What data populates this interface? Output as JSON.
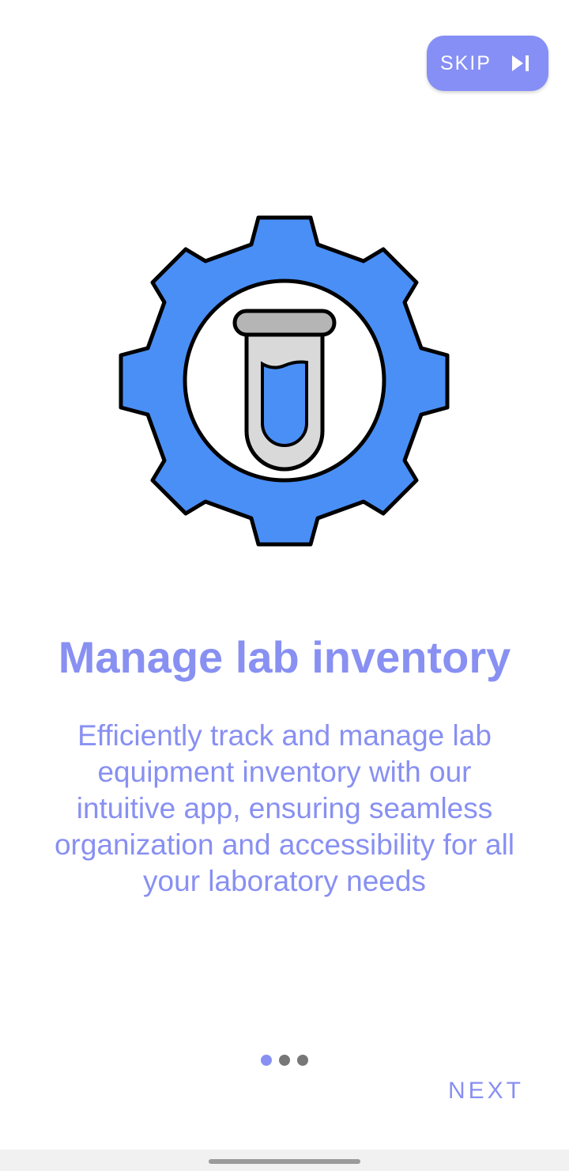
{
  "header": {
    "skip_label": "SKIP",
    "skip_icon": "skip-next-icon"
  },
  "hero": {
    "icon": "gear-test-tube-icon",
    "colors": {
      "gear": "#4a8ff6",
      "tube_liquid": "#4a8ff6",
      "tube_body": "#d9d9d9",
      "tube_cap": "#b5b5b5"
    }
  },
  "content": {
    "title": "Manage lab inventory",
    "description": "Efficiently track and manage lab equipment inventory with our intuitive app, ensuring seamless organization and accessibility for all your laboratory needs"
  },
  "pager": {
    "total": 3,
    "active_index": 0,
    "active_color": "#8890f2",
    "inactive_color": "#777777"
  },
  "footer": {
    "next_label": "NEXT"
  },
  "theme": {
    "accent": "#8890f2",
    "skip_background": "#868ff5"
  }
}
